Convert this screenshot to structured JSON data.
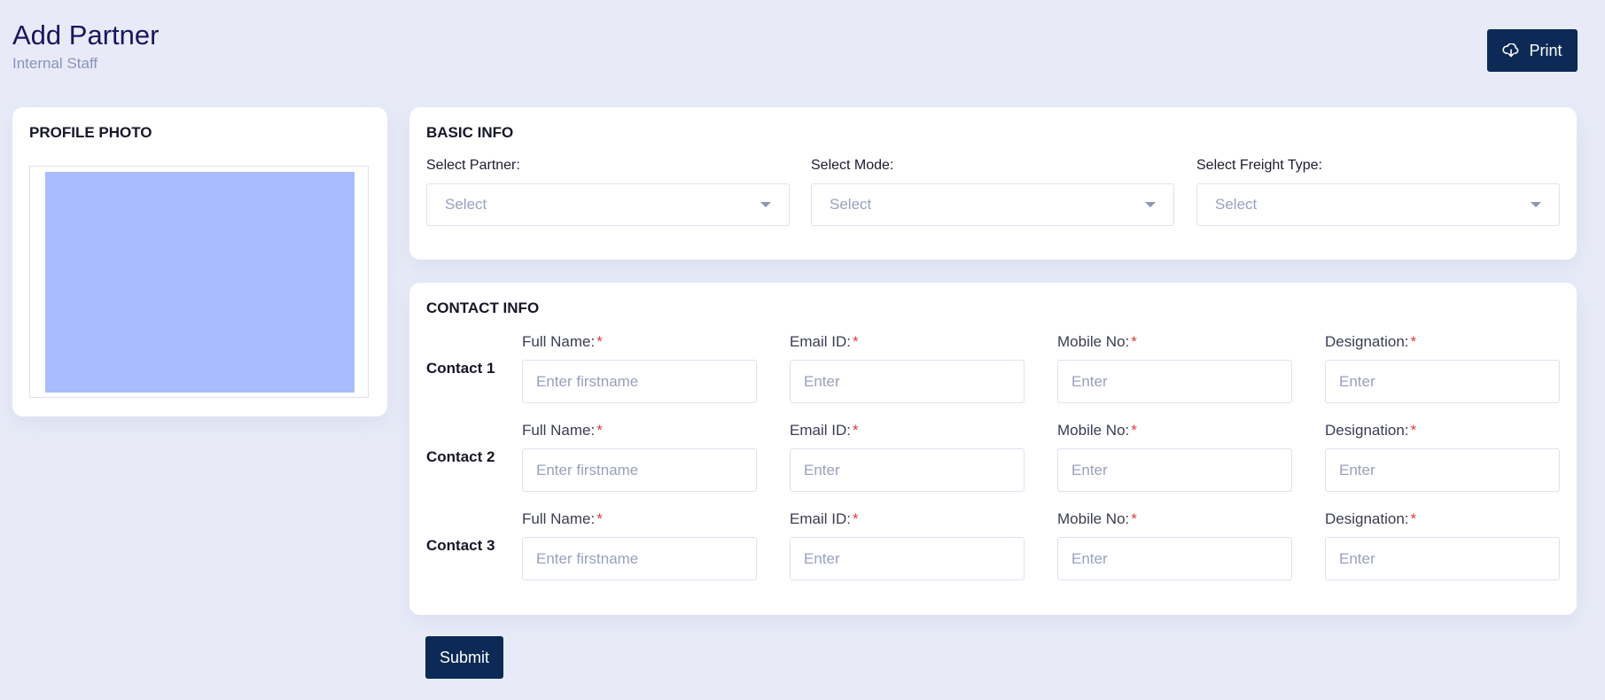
{
  "header": {
    "title": "Add Partner",
    "subtitle": "Internal Staff",
    "print_label": "Print",
    "print_icon": "cloud-download-icon"
  },
  "profile": {
    "title": "PROFILE PHOTO",
    "placeholder_color": "#a8bcff"
  },
  "basic_info": {
    "title": "BASIC INFO",
    "selects": [
      {
        "label": "Select Partner:",
        "value": "Select"
      },
      {
        "label": "Select Mode:",
        "value": "Select"
      },
      {
        "label": "Select Freight Type:",
        "value": "Select"
      }
    ]
  },
  "contact_info": {
    "title": "CONTACT INFO",
    "required_marker": "*",
    "fields": [
      {
        "label": "Full Name:",
        "placeholder": "Enter firstname"
      },
      {
        "label": "Email ID:",
        "placeholder": "Enter"
      },
      {
        "label": "Mobile No:",
        "placeholder": "Enter"
      },
      {
        "label": "Designation:",
        "placeholder": "Enter"
      }
    ],
    "contacts": [
      {
        "label": "Contact 1"
      },
      {
        "label": "Contact 2"
      },
      {
        "label": "Contact 3"
      }
    ]
  },
  "submit_label": "Submit",
  "colors": {
    "background": "#e8ebf7",
    "primary_button": "#0c2a55",
    "title": "#17175e",
    "required": "#e03a3a"
  }
}
